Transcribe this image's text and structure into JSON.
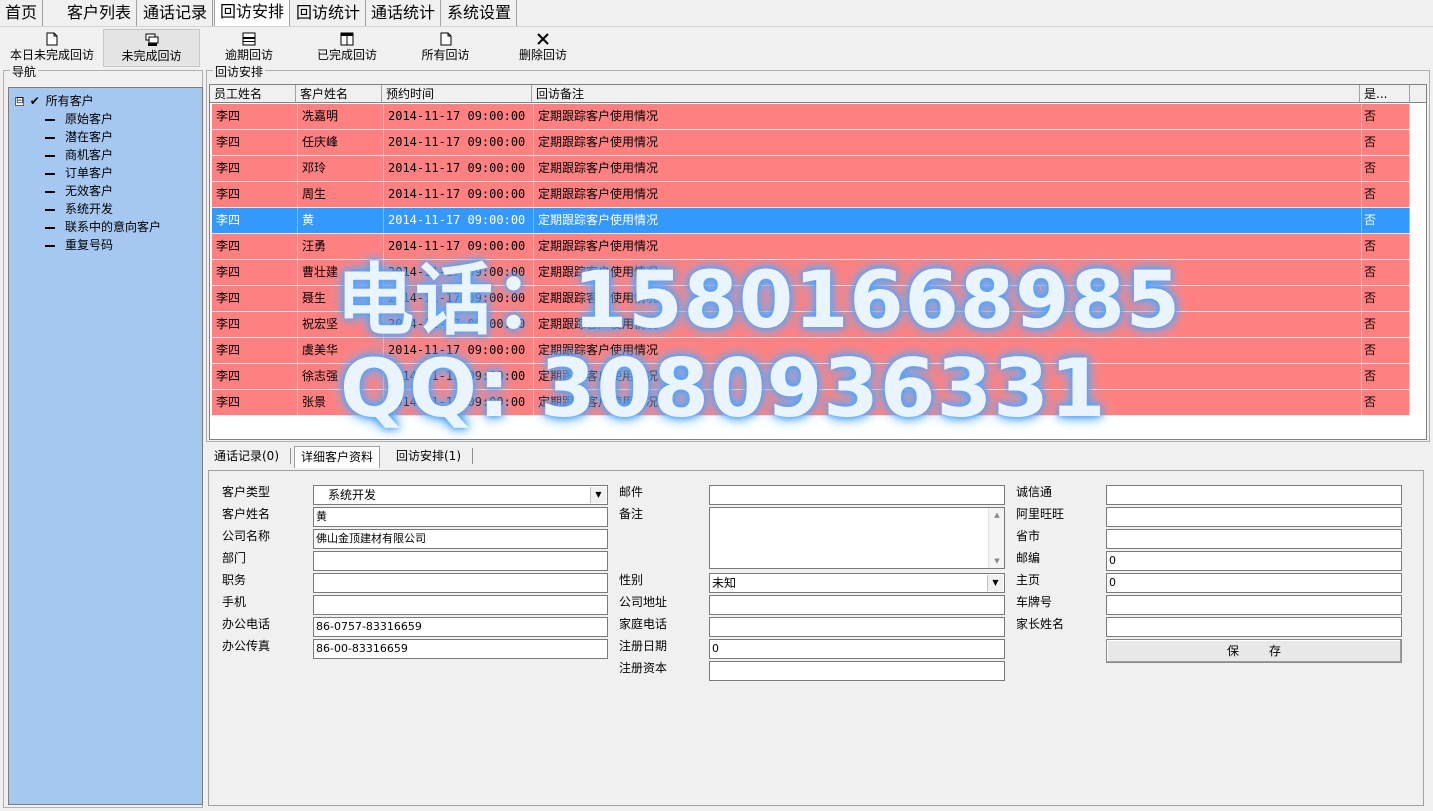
{
  "menu": {
    "tabs": [
      "首页",
      "客户列表",
      "通话记录",
      "回访安排",
      "回访统计",
      "通话统计",
      "系统设置"
    ],
    "active_index": 3
  },
  "toolbar": {
    "buttons": [
      {
        "label": "本日未完成回访",
        "icon": "page-icon"
      },
      {
        "label": "未完成回访",
        "icon": "stack-icon",
        "active": true
      },
      {
        "label": "逾期回访",
        "icon": "list-icon"
      },
      {
        "label": "已完成回访",
        "icon": "columns-icon"
      },
      {
        "label": "所有回访",
        "icon": "page-icon"
      },
      {
        "label": "删除回访",
        "icon": "close-icon"
      }
    ]
  },
  "nav": {
    "legend": "导航",
    "root": {
      "toggle": "⊟",
      "check": "✔",
      "label": "所有客户"
    },
    "items": [
      "原始客户",
      "潜在客户",
      "商机客户",
      "订单客户",
      "无效客户",
      "系统开发",
      "联系中的意向客户",
      "重复号码"
    ]
  },
  "schedule": {
    "legend": "回访安排",
    "columns": [
      "员工姓名",
      "客户姓名",
      "预约时间",
      "回访备注",
      "是..."
    ],
    "selected_index": 4,
    "rows": [
      [
        "李四",
        "冼嘉明",
        "2014-11-17 09:00:00",
        "定期跟踪客户使用情况",
        "否"
      ],
      [
        "李四",
        "任庆峰",
        "2014-11-17 09:00:00",
        "定期跟踪客户使用情况",
        "否"
      ],
      [
        "李四",
        "邓玲",
        "2014-11-17 09:00:00",
        "定期跟踪客户使用情况",
        "否"
      ],
      [
        "李四",
        "周生",
        "2014-11-17 09:00:00",
        "定期跟踪客户使用情况",
        "否"
      ],
      [
        "李四",
        "黄",
        "2014-11-17 09:00:00",
        "定期跟踪客户使用情况",
        "否"
      ],
      [
        "李四",
        "汪勇",
        "2014-11-17 09:00:00",
        "定期跟踪客户使用情况",
        "否"
      ],
      [
        "李四",
        "曹壮建",
        "2014-11-17 09:00:00",
        "定期跟踪客户使用情况",
        "否"
      ],
      [
        "李四",
        "聂生",
        "2014-11-17 09:00:00",
        "定期跟踪客户使用情况",
        "否"
      ],
      [
        "李四",
        "祝宏坚",
        "2014-11-17 09:00:00",
        "定期跟踪客户使用情况",
        "否"
      ],
      [
        "李四",
        "虞美华",
        "2014-11-17 09:00:00",
        "定期跟踪客户使用情况",
        "否"
      ],
      [
        "李四",
        "徐志强",
        "2014-11-17 09:00:00",
        "定期跟踪客户使用情况",
        "否"
      ],
      [
        "李四",
        "张景",
        "2014-11-17 09:00:00",
        "定期跟踪客户使用情况",
        "否"
      ]
    ]
  },
  "detail_tabs": [
    "通话记录(0)",
    "详细客户资料",
    "回访安排(1)"
  ],
  "detail_active": 1,
  "form": {
    "customer_type": {
      "label": "客户类型",
      "value": "系统开发"
    },
    "customer_name": {
      "label": "客户姓名",
      "value": "黄"
    },
    "company_name": {
      "label": "公司名称",
      "value": "佛山金顶建材有限公司"
    },
    "department": {
      "label": "部门",
      "value": ""
    },
    "position": {
      "label": "职务",
      "value": ""
    },
    "mobile": {
      "label": "手机",
      "value": ""
    },
    "office_phone": {
      "label": "办公电话",
      "value": "86-0757-83316659"
    },
    "office_fax": {
      "label": "办公传真",
      "value": "86-00-83316659"
    },
    "email": {
      "label": "邮件",
      "value": ""
    },
    "remark": {
      "label": "备注",
      "value": ""
    },
    "gender": {
      "label": "性别",
      "value": "未知"
    },
    "company_address": {
      "label": "公司地址",
      "value": ""
    },
    "home_phone": {
      "label": "家庭电话",
      "value": ""
    },
    "reg_date": {
      "label": "注册日期",
      "value": "0"
    },
    "reg_capital": {
      "label": "注册资本",
      "value": ""
    },
    "chengxintong": {
      "label": "诚信通",
      "value": ""
    },
    "aliwangwang": {
      "label": "阿里旺旺",
      "value": ""
    },
    "province_city": {
      "label": "省市",
      "value": ""
    },
    "postcode": {
      "label": "邮编",
      "value": "0"
    },
    "homepage": {
      "label": "主页",
      "value": "0"
    },
    "plate_number": {
      "label": "车牌号",
      "value": ""
    },
    "parent_name": {
      "label": "家长姓名",
      "value": ""
    },
    "save_label": "保存"
  },
  "watermark": {
    "line1": "电话：15801668985",
    "line2": "QQ: 3080936331"
  }
}
